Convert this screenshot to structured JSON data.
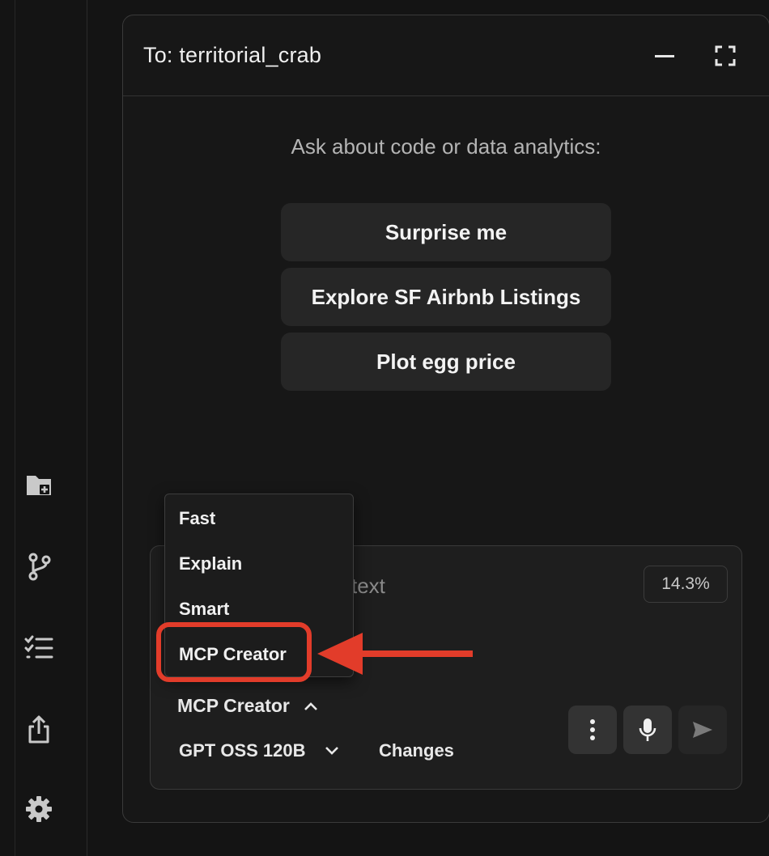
{
  "sidebar": {
    "items": [
      {
        "name": "new-folder-icon"
      },
      {
        "name": "branch-icon"
      },
      {
        "name": "checklist-icon"
      },
      {
        "name": "share-icon"
      },
      {
        "name": "gear-icon"
      }
    ],
    "icon_color": "#c9c9c9"
  },
  "chat": {
    "recipient_label": "To: territorial_crab",
    "prompt_heading": "Ask about code or data analytics:",
    "suggestions": [
      "Surprise me",
      "Explore SF Airbnb Listings",
      "Plot egg price"
    ]
  },
  "composer": {
    "placeholder_fragment": "text",
    "context_usage": "14.3%",
    "mode": {
      "selected": "MCP Creator",
      "options": [
        "Fast",
        "Explain",
        "Smart",
        "MCP Creator"
      ],
      "expanded": true
    },
    "model": "GPT OSS 120B",
    "changes_label": "Changes"
  },
  "annotation": {
    "highlighted_option": "MCP Creator",
    "color": "#e23c2a"
  },
  "colors": {
    "background": "#141414",
    "panel": "#171717",
    "suggestion_bg": "#262626",
    "accent_annotation": "#e23c2a"
  }
}
